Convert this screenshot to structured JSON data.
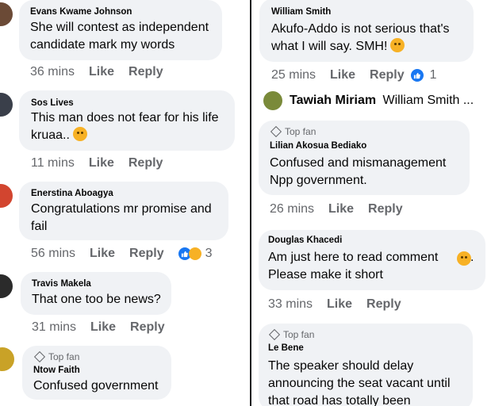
{
  "left_comments": [
    {
      "name": "Evans Kwame Johnson",
      "text": "She will contest as independent\ncandidate mark my words",
      "time": "36 mins",
      "like": "Like",
      "reply": "Reply"
    },
    {
      "name": "Sos Lives",
      "text": "This man does not fear for his life\nkruaa..",
      "time": "11 mins",
      "like": "Like",
      "reply": "Reply"
    },
    {
      "name": "Enerstina Aboagya",
      "text": "Congratulations mr promise and\nfail",
      "time": "56 mins",
      "like": "Like",
      "reply": "Reply",
      "reaction_count": "3"
    },
    {
      "name": "Travis Makela",
      "text": "That one too be news?",
      "time": "31 mins",
      "like": "Like",
      "reply": "Reply"
    },
    {
      "badge": "Top fan",
      "name": "Ntow Faith",
      "text": "Confused government"
    }
  ],
  "right_comments": [
    {
      "name": "William Smith",
      "text": "Akufo-Addo is not serious that's\nwhat I will say. SMH!",
      "time": "25 mins",
      "like": "Like",
      "reply": "Reply",
      "reaction_count": "1"
    },
    {
      "badge": "Top fan",
      "name": "Lilian Akosua Bediako",
      "text": "Confused and mismanagement\nNpp government.",
      "time": "26 mins",
      "like": "Like",
      "reply": "Reply"
    },
    {
      "name": "Douglas Khacedi",
      "text": "Am just here to read comment\nPlease make it short",
      "time": "33 mins",
      "like": "Like",
      "reply": "Reply"
    },
    {
      "badge": "Top fan",
      "name": "Le Bene",
      "text": "The speaker should delay\nannouncing the seat vacant until\nthat road has totally been"
    }
  ],
  "reply_preview": {
    "name": "Tawiah Miriam",
    "text": "William Smith ..."
  },
  "colors": {
    "bubble": "#f0f2f5",
    "meta": "#65676b",
    "like_blue": "#1877f2",
    "haha_yellow": "#f7b125"
  }
}
